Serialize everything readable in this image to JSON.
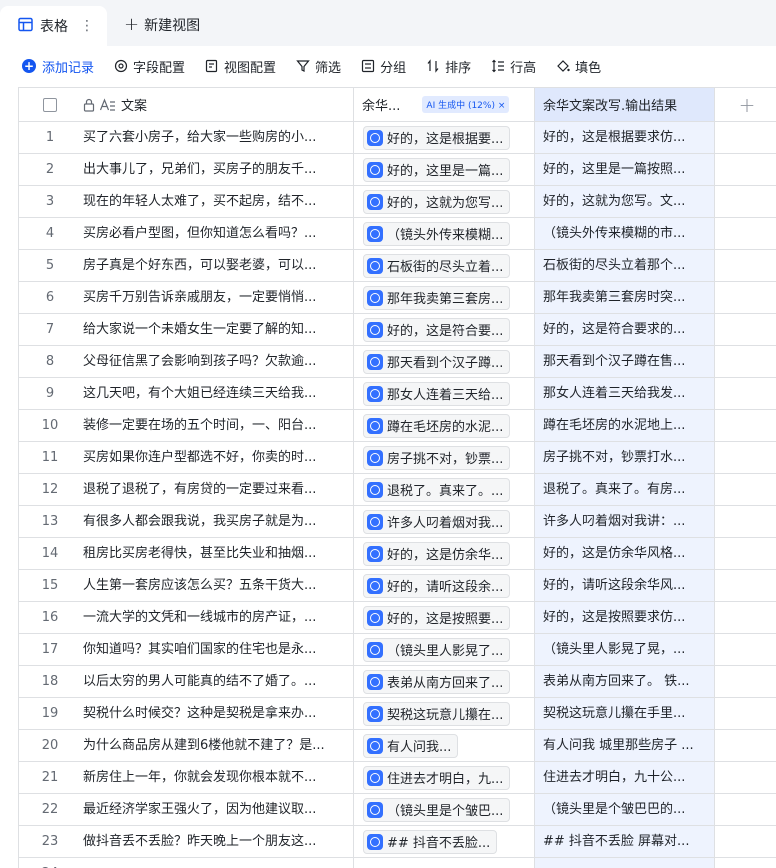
{
  "tabs": {
    "active_label": "表格",
    "more": "⋮",
    "new_view_label": "新建视图"
  },
  "toolbar": {
    "add_record": "添加记录",
    "field_config": "字段配置",
    "view_config": "视图配置",
    "filter": "筛选",
    "group": "分组",
    "sort": "排序",
    "row_height": "行高",
    "fill": "填色"
  },
  "columns": {
    "text": "文案",
    "ai": "余华...",
    "ai_badge": "AI 生成中 (12%) ×",
    "output": "余华文案改写.输出结果",
    "add": "+"
  },
  "rows": [
    {
      "idx": "1",
      "text": "买了六套小房子，给大家一些购房的小...",
      "ai": "好的，这是根据要...",
      "out": "好的，这是根据要求仿..."
    },
    {
      "idx": "2",
      "text": "出大事儿了，兄弟们，买房子的朋友千...",
      "ai": "好的，这里是一篇...",
      "out": "好的，这里是一篇按照..."
    },
    {
      "idx": "3",
      "text": "现在的年轻人太难了，买不起房，结不...",
      "ai": "好的，这就为您写...",
      "out": "好的，这就为您写。文..."
    },
    {
      "idx": "4",
      "text": "买房必看户型图，但你知道怎么看吗？...",
      "ai": "（镜头外传来模糊...",
      "out": "（镜头外传来模糊的市..."
    },
    {
      "idx": "5",
      "text": "房子真是个好东西，可以娶老婆，可以...",
      "ai": "石板街的尽头立着...",
      "out": "石板街的尽头立着那个..."
    },
    {
      "idx": "6",
      "text": "买房千万别告诉亲戚朋友，一定要悄悄...",
      "ai": "那年我卖第三套房...",
      "out": "那年我卖第三套房时突..."
    },
    {
      "idx": "7",
      "text": "给大家说一个未婚女生一定要了解的知...",
      "ai": "好的，这是符合要...",
      "out": "好的，这是符合要求的..."
    },
    {
      "idx": "8",
      "text": "父母征信黑了会影响到孩子吗？欠款逾...",
      "ai": "那天看到个汉子蹲...",
      "out": "那天看到个汉子蹲在售..."
    },
    {
      "idx": "9",
      "text": "这几天吧，有个大姐已经连续三天给我...",
      "ai": "那女人连着三天给...",
      "out": "那女人连着三天给我发..."
    },
    {
      "idx": "10",
      "text": "装修一定要在场的五个时间，一、阳台...",
      "ai": "蹲在毛坯房的水泥...",
      "out": "蹲在毛坯房的水泥地上..."
    },
    {
      "idx": "11",
      "text": "买房如果你连户型都选不好，你卖的时...",
      "ai": "房子挑不对，钞票...",
      "out": "房子挑不对，钞票打水..."
    },
    {
      "idx": "12",
      "text": "退税了退税了，有房贷的一定要过来看...",
      "ai": "退税了。真来了。...",
      "out": "退税了。真来了。有房..."
    },
    {
      "idx": "13",
      "text": "有很多人都会跟我说，我买房子就是为...",
      "ai": "许多人叼着烟对我...",
      "out": "许多人叼着烟对我讲：..."
    },
    {
      "idx": "14",
      "text": "租房比买房老得快，甚至比失业和抽烟...",
      "ai": "好的，这是仿余华...",
      "out": "好的，这是仿余华风格..."
    },
    {
      "idx": "15",
      "text": "人生第一套房应该怎么买？五条干货大...",
      "ai": "好的，请听这段余...",
      "out": "好的，请听这段余华风..."
    },
    {
      "idx": "16",
      "text": "一流大学的文凭和一线城市的房产证，...",
      "ai": "好的，这是按照要...",
      "out": "好的，这是按照要求仿..."
    },
    {
      "idx": "17",
      "text": "你知道吗？其实咱们国家的住宅也是永...",
      "ai": "（镜头里人影晃了...",
      "out": "（镜头里人影晃了晃，..."
    },
    {
      "idx": "18",
      "text": "以后太穷的男人可能真的结不了婚了。...",
      "ai": "表弟从南方回来了...",
      "out": "表弟从南方回来了。 铁..."
    },
    {
      "idx": "19",
      "text": "契税什么时候交？这种是契税是拿来办...",
      "ai": "契税这玩意儿攥在...",
      "out": "契税这玩意儿攥在手里..."
    },
    {
      "idx": "20",
      "text": "为什么商品房从建到6楼他就不建了？是...",
      "ai": "有人问我...",
      "out": "有人问我 城里那些房子 ..."
    },
    {
      "idx": "21",
      "text": "新房住上一年，你就会发现你根本就不...",
      "ai": "住进去才明白，九...",
      "out": "住进去才明白，九十公..."
    },
    {
      "idx": "22",
      "text": "最近经济学家王强火了，因为他建议取...",
      "ai": "（镜头里是个皱巴...",
      "out": "（镜头里是个皱巴巴的..."
    },
    {
      "idx": "23",
      "text": "做抖音丢不丢脸？昨天晚上一个朋友这...",
      "ai": "## 抖音不丢脸...",
      "out": "## 抖音不丢脸 屏幕对..."
    },
    {
      "idx": "24",
      "text": "",
      "ai": "",
      "out": ""
    }
  ],
  "colors": {
    "accent": "#1456f0",
    "output_column_bg": "#eef3fe",
    "border": "#dee0e3"
  }
}
